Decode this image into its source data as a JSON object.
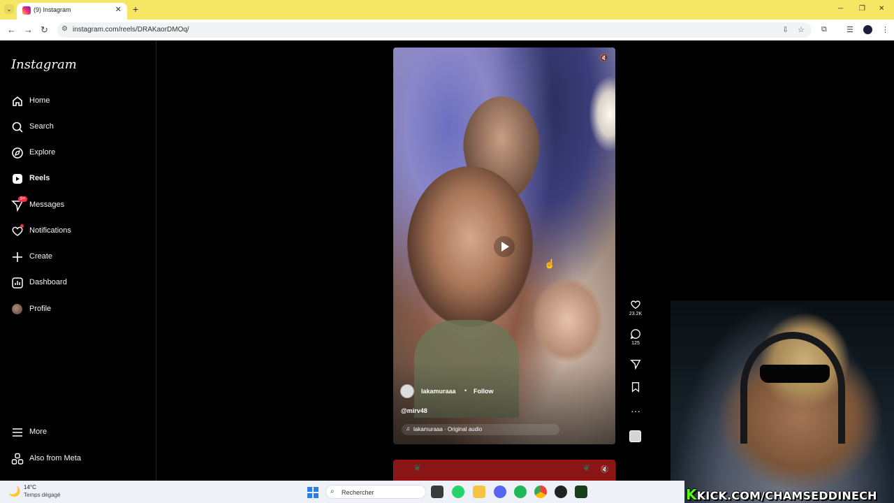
{
  "browser": {
    "tab_title": "(9) Instagram",
    "tab_close": "✕",
    "new_tab": "+",
    "url": "instagram.com/reels/DRAKaorDMOq/"
  },
  "sidebar": {
    "logo": "Instagram",
    "items": [
      {
        "label": "Home",
        "icon": "home-icon"
      },
      {
        "label": "Search",
        "icon": "search-icon"
      },
      {
        "label": "Explore",
        "icon": "compass-icon"
      },
      {
        "label": "Reels",
        "icon": "reels-icon"
      },
      {
        "label": "Messages",
        "icon": "messenger-icon"
      },
      {
        "label": "Notifications",
        "icon": "heart-icon"
      },
      {
        "label": "Create",
        "icon": "plus-icon"
      },
      {
        "label": "Dashboard",
        "icon": "dashboard-icon"
      },
      {
        "label": "Profile",
        "icon": "avatar"
      },
      {
        "label": "More",
        "icon": "menu-icon"
      },
      {
        "label": "Also from Meta",
        "icon": "meta-apps-icon"
      }
    ],
    "messages_badge": "9+"
  },
  "reel": {
    "username": "lakamuraaa",
    "separator": "•",
    "follow_label": "Follow",
    "caption": "@mirv48",
    "audio": "lakamuraaa · Original audio",
    "likes": "23.2K",
    "comments": "125"
  },
  "overlay": {
    "kick_k": "K",
    "kick_text": "KICK.COM/CHAMSEDDINECH"
  },
  "taskbar": {
    "temp": "14°C",
    "weather": "Temps dégagé",
    "search_placeholder": "Rechercher"
  },
  "colors": {
    "tab_strip": "#f5e663",
    "instagram_bg": "#000000",
    "notification_red": "#ff3040",
    "kick_green": "#53fc18"
  }
}
